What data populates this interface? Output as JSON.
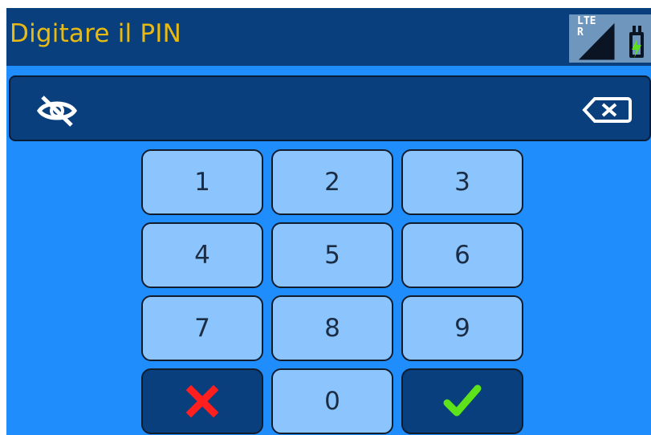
{
  "header": {
    "title": "Digitare il PIN"
  },
  "status": {
    "network_label": "LTE\nR",
    "signal_icon": "signal-icon",
    "battery_icon": "battery-charging-icon"
  },
  "pin_bar": {
    "visibility_icon": "eye-off-icon",
    "backspace_icon": "backspace-icon"
  },
  "keypad": {
    "keys": [
      "1",
      "2",
      "3",
      "4",
      "5",
      "6",
      "7",
      "8",
      "9"
    ],
    "zero": "0",
    "cancel_icon": "cross-icon",
    "confirm_icon": "check-icon"
  },
  "colors": {
    "header_bg": "#083f7c",
    "title": "#e9bb12",
    "panel_bg": "#1f8dfb",
    "key_bg": "#8cc5fe",
    "key_dark_bg": "#083f7c",
    "cancel": "#ff1f1f",
    "confirm": "#5ee31a"
  }
}
